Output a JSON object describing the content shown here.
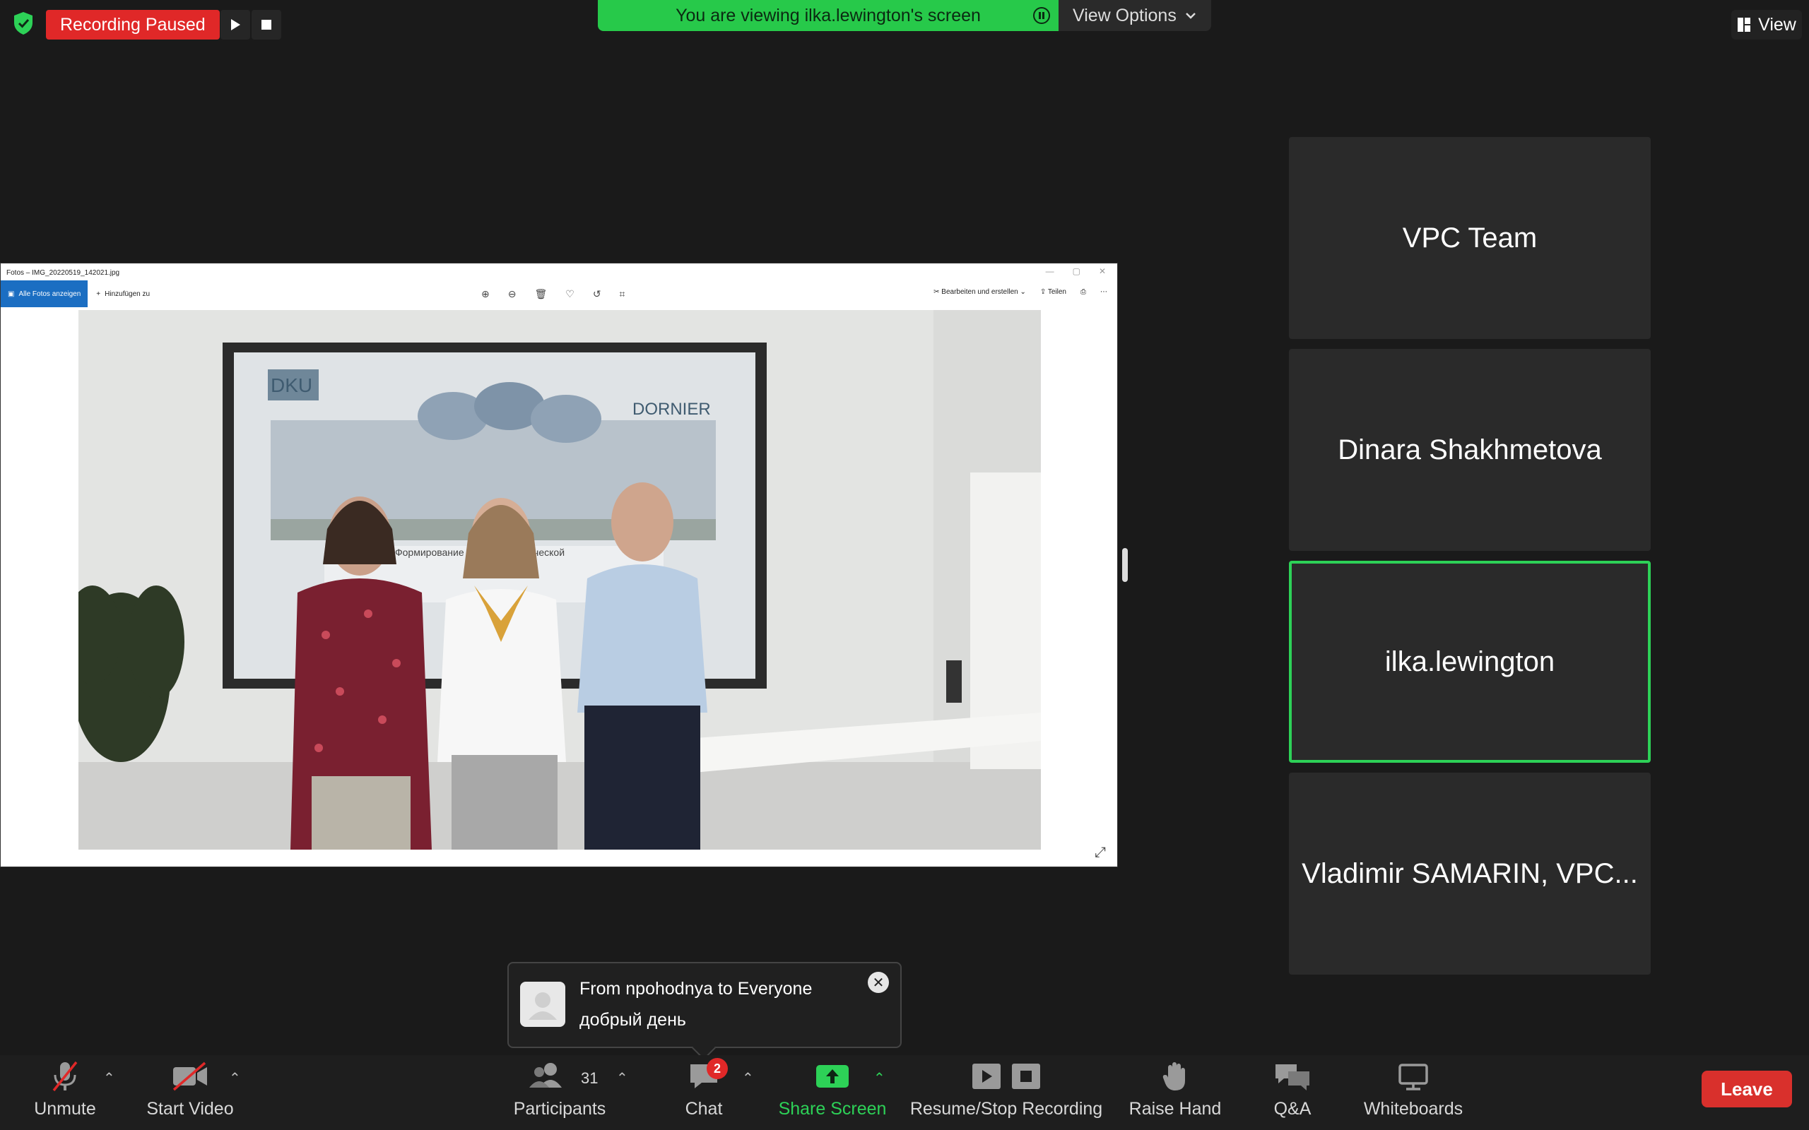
{
  "top": {
    "recording_status": "Recording Paused",
    "viewing_banner": "You are viewing ilka.lewington's screen",
    "view_options": "View Options",
    "view": "View"
  },
  "shared_screen": {
    "window_title": "Fotos – IMG_20220519_142021.jpg",
    "toolbar": {
      "all_photos": "Alle Fotos anzeigen",
      "add_to": "Hinzufügen zu",
      "edit_create": "Bearbeiten und erstellen",
      "share": "Teilen"
    },
    "slide": {
      "logo_left": "DKU",
      "logo_right": "DORNIER",
      "text": "Формирование теплоэнергетической"
    }
  },
  "gallery": {
    "tiles": [
      {
        "name": "VPC Team",
        "active": false
      },
      {
        "name": "Dinara Shakhmetova",
        "active": false
      },
      {
        "name": "ilka.lewington",
        "active": true
      },
      {
        "name": "Vladimir SAMARIN, VPC...",
        "active": false
      }
    ]
  },
  "chat_toast": {
    "from": "From npohodnya to Everyone",
    "message": "добрый день"
  },
  "toolbar": {
    "unmute": "Unmute",
    "start_video": "Start Video",
    "participants": "Participants",
    "participants_count": "31",
    "chat": "Chat",
    "chat_badge": "2",
    "share_screen": "Share Screen",
    "recording": "Resume/Stop Recording",
    "raise_hand": "Raise Hand",
    "qa": "Q&A",
    "whiteboards": "Whiteboards",
    "leave": "Leave"
  },
  "colors": {
    "accent_green": "#27c94a",
    "recording_red": "#e02828",
    "leave_red": "#d9302c",
    "background": "#1a1a1a"
  }
}
